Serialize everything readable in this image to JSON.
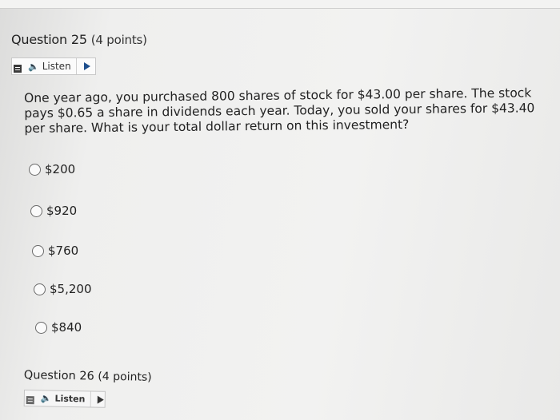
{
  "question": {
    "title": "Question 25",
    "points": "(4 points)",
    "listen_label": "Listen",
    "text": "One year ago, you purchased 800 shares of stock for $43.00 per share. The stock pays $0.65 a share in dividends each year. Today, you sold your shares for $43.40 per share. What is your total dollar return on this investment?",
    "options": [
      {
        "label": "$200"
      },
      {
        "label": "$920"
      },
      {
        "label": "$760"
      },
      {
        "label": "$5,200"
      },
      {
        "label": "$840"
      }
    ]
  },
  "next_question": {
    "title": "Question 26",
    "points": "(4 points)",
    "listen_label": "Listen"
  },
  "icons": {
    "speaker": "speaker-icon",
    "play": "play-icon",
    "menu": "menu-icon"
  },
  "colors": {
    "play_accent": "#1e4e8c",
    "background": "#efefee"
  }
}
